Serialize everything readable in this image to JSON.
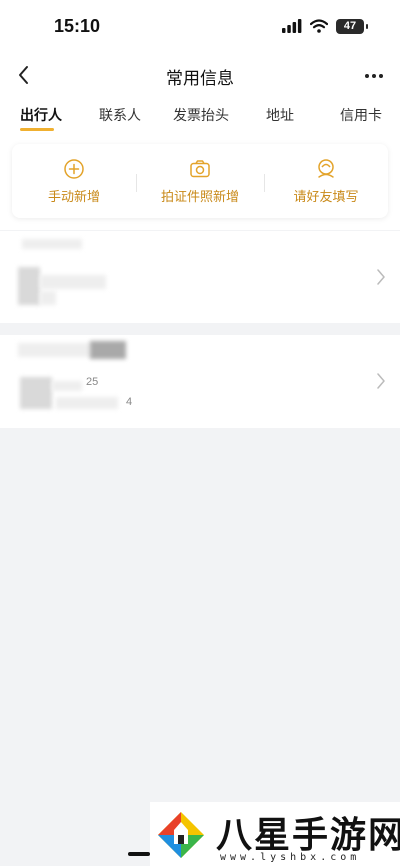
{
  "status_bar": {
    "time": "15:10",
    "battery": "47"
  },
  "nav": {
    "title": "常用信息"
  },
  "tabs": [
    {
      "label": "出行人",
      "active": true
    },
    {
      "label": "联系人",
      "active": false
    },
    {
      "label": "发票抬头",
      "active": false
    },
    {
      "label": "地址",
      "active": false
    },
    {
      "label": "信用卡",
      "active": false
    }
  ],
  "actions": [
    {
      "label": "手动新增",
      "icon": "plus-circle-icon"
    },
    {
      "label": "拍证件照新增",
      "icon": "camera-icon"
    },
    {
      "label": "请好友填写",
      "icon": "friend-icon"
    }
  ],
  "passengers": [
    {
      "detail_1": "",
      "detail_2": ""
    },
    {
      "detail_1": "25",
      "detail_2": "4"
    }
  ],
  "watermark": {
    "title": "八星手游网",
    "url": "www.lyshbx.com"
  },
  "colors": {
    "accent": "#f0b030",
    "action_text": "#c98a1a",
    "background": "#f2f3f5"
  }
}
